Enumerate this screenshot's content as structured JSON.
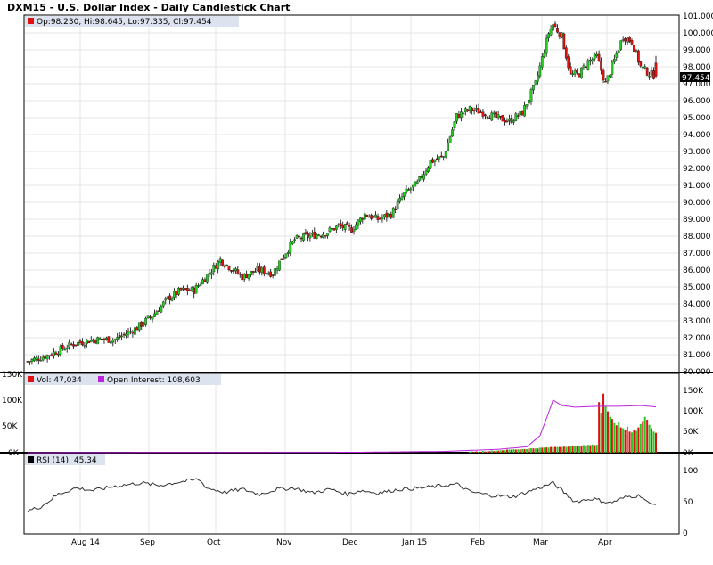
{
  "title": "DXM15 - U.S. Dollar Index - Daily Candlestick Chart",
  "price_panel": {
    "legend": "Op:98.230, Hi:98.645, Lo:97.335, Cl:97.454",
    "last_price_label": "97.454",
    "y_ticks": [
      "101.000",
      "100.000",
      "99.000",
      "98.000",
      "97.000",
      "96.000",
      "95.000",
      "94.000",
      "93.000",
      "92.000",
      "91.000",
      "90.000",
      "89.000",
      "88.000",
      "87.000",
      "86.000",
      "85.000",
      "84.000",
      "83.000",
      "82.000",
      "81.000",
      "80.000"
    ]
  },
  "volume_panel": {
    "vol_legend": "Vol: 47,034",
    "oi_legend": "Open Interest: 108,603",
    "left_ticks": [
      "150K",
      "100K",
      "50K",
      "0K"
    ],
    "right_ticks": [
      "150K",
      "100K",
      "50K",
      "0K"
    ]
  },
  "rsi_panel": {
    "legend": "RSI (14): 45.34",
    "right_ticks": [
      "100",
      "50",
      "0"
    ]
  },
  "x_labels": [
    "Aug 14",
    "Sep",
    "Oct",
    "Nov",
    "Dec",
    "Jan 15",
    "Feb",
    "Mar",
    "Apr"
  ],
  "colors": {
    "up": "#22cc22",
    "down": "#dd1111",
    "oi": "#bb22dd",
    "rsi": "#333333",
    "legend_bg": "#dde3ee"
  },
  "chart_data": [
    {
      "type": "candlestick",
      "title": "DXM15 - U.S. Dollar Index - Daily Candlestick Chart",
      "ylim": [
        80,
        101
      ],
      "last": {
        "open": 98.23,
        "high": 98.645,
        "low": 97.335,
        "close": 97.454
      },
      "close_anchors": [
        [
          0,
          80.6
        ],
        [
          10,
          81.0
        ],
        [
          20,
          81.6
        ],
        [
          30,
          81.9
        ],
        [
          40,
          81.9
        ],
        [
          50,
          82.6
        ],
        [
          57,
          83.3
        ],
        [
          64,
          84.3
        ],
        [
          70,
          84.8
        ],
        [
          76,
          84.8
        ],
        [
          82,
          85.7
        ],
        [
          88,
          86.6
        ],
        [
          92,
          86.2
        ],
        [
          98,
          85.6
        ],
        [
          105,
          86.0
        ],
        [
          112,
          85.8
        ],
        [
          116,
          86.7
        ],
        [
          122,
          87.8
        ],
        [
          128,
          88.0
        ],
        [
          136,
          88.2
        ],
        [
          142,
          88.6
        ],
        [
          148,
          88.4
        ],
        [
          154,
          89.3
        ],
        [
          160,
          89.0
        ],
        [
          166,
          89.3
        ],
        [
          172,
          90.5
        ],
        [
          178,
          91.1
        ],
        [
          184,
          92.4
        ],
        [
          190,
          92.7
        ],
        [
          196,
          95.1
        ],
        [
          202,
          95.5
        ],
        [
          208,
          95.3
        ],
        [
          214,
          95.0
        ],
        [
          220,
          94.8
        ],
        [
          226,
          95.3
        ],
        [
          232,
          97.0
        ],
        [
          238,
          100.0
        ],
        [
          240,
          100.5
        ],
        [
          244,
          99.8
        ],
        [
          248,
          97.5
        ],
        [
          252,
          97.6
        ],
        [
          256,
          98.3
        ],
        [
          260,
          98.6
        ],
        [
          264,
          97.0
        ],
        [
          268,
          98.4
        ],
        [
          272,
          99.8
        ],
        [
          276,
          99.5
        ],
        [
          280,
          98.0
        ],
        [
          284,
          97.6
        ],
        [
          287,
          97.454
        ]
      ]
    },
    {
      "type": "bar",
      "series_name": "Vol",
      "last_value": 47034,
      "ylim": [
        0,
        150000
      ],
      "values_recent": [
        120000,
        95000,
        140000,
        110000,
        98000,
        85000,
        80000,
        70000,
        65000,
        72000,
        60000,
        58000,
        55000,
        62000,
        50000,
        48000,
        55000,
        52000,
        60000,
        68000,
        75000,
        85000,
        78000,
        66000,
        58000,
        50000,
        47034
      ]
    },
    {
      "type": "line",
      "series_name": "Open Interest",
      "last_value": 108603,
      "ylim": [
        0,
        150000
      ],
      "anchors": [
        [
          0,
          0
        ],
        [
          150,
          1000
        ],
        [
          190,
          3000
        ],
        [
          215,
          8000
        ],
        [
          228,
          14000
        ],
        [
          234,
          40000
        ],
        [
          238,
          95000
        ],
        [
          240,
          125000
        ],
        [
          244,
          112000
        ],
        [
          250,
          108000
        ],
        [
          260,
          110000
        ],
        [
          270,
          110000
        ],
        [
          280,
          112000
        ],
        [
          287,
          108603
        ]
      ]
    },
    {
      "type": "line",
      "series_name": "RSI (14)",
      "last_value": 45.34,
      "ylim": [
        0,
        100
      ],
      "anchors": [
        [
          0,
          35
        ],
        [
          6,
          42
        ],
        [
          14,
          62
        ],
        [
          22,
          72
        ],
        [
          30,
          68
        ],
        [
          40,
          75
        ],
        [
          52,
          80
        ],
        [
          60,
          76
        ],
        [
          70,
          82
        ],
        [
          78,
          86
        ],
        [
          82,
          72
        ],
        [
          90,
          65
        ],
        [
          98,
          70
        ],
        [
          106,
          62
        ],
        [
          114,
          70
        ],
        [
          122,
          72
        ],
        [
          130,
          64
        ],
        [
          138,
          70
        ],
        [
          146,
          62
        ],
        [
          152,
          68
        ],
        [
          160,
          64
        ],
        [
          170,
          70
        ],
        [
          180,
          72
        ],
        [
          190,
          76
        ],
        [
          196,
          78
        ],
        [
          202,
          66
        ],
        [
          212,
          60
        ],
        [
          222,
          58
        ],
        [
          230,
          68
        ],
        [
          236,
          75
        ],
        [
          240,
          80
        ],
        [
          244,
          68
        ],
        [
          250,
          50
        ],
        [
          258,
          55
        ],
        [
          266,
          48
        ],
        [
          274,
          58
        ],
        [
          280,
          60
        ],
        [
          284,
          46
        ],
        [
          287,
          45.34
        ]
      ]
    }
  ]
}
